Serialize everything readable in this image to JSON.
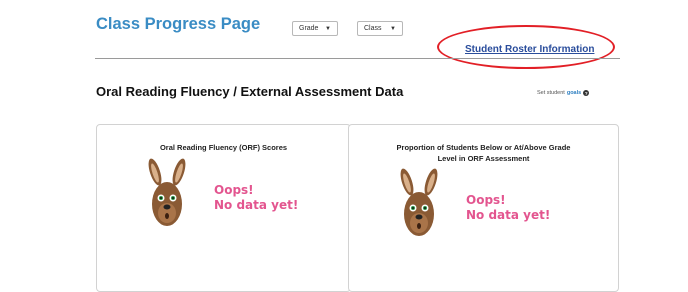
{
  "header": {
    "title": "Class Progress Page",
    "grade_select": {
      "value": "Grade"
    },
    "class_select": {
      "value": "Class"
    },
    "roster_link": "Student Roster Information"
  },
  "section": {
    "title": "Oral Reading Fluency / External Assessment Data",
    "goals_prefix": "Set student",
    "goals_word": "goals",
    "help_icon": "?"
  },
  "cards": [
    {
      "title": "Oral Reading Fluency (ORF) Scores",
      "empty_line1": "Oops!",
      "empty_line2": "No data yet!"
    },
    {
      "title": "Proportion of Students Below or At/Above Grade Level in ORF Assessment",
      "empty_line1": "Oops!",
      "empty_line2": "No data yet!"
    }
  ],
  "colors": {
    "title_blue": "#3a8cc4",
    "link_blue": "#2a4d9c",
    "annotation_red": "#e21f26",
    "oops_pink": "#e3558f"
  }
}
